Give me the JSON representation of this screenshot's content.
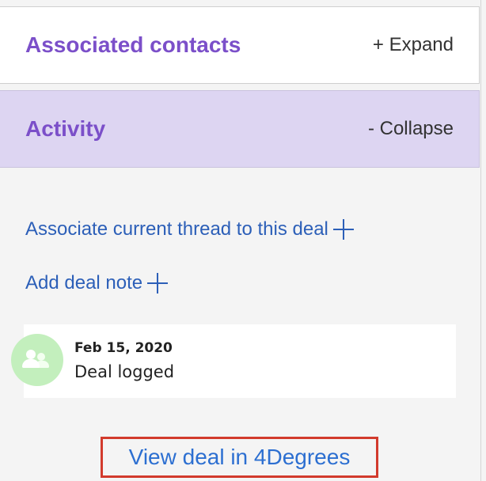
{
  "associated_contacts": {
    "title": "Associated contacts",
    "toggle_label": "+ Expand"
  },
  "activity": {
    "title": "Activity",
    "toggle_label": "- Collapse",
    "associate_thread_label": "Associate current thread to this deal",
    "add_note_label": "Add deal note",
    "items": [
      {
        "date": "Feb 15, 2020",
        "text": "Deal logged",
        "avatar_icon": "people-icon"
      }
    ]
  },
  "footer": {
    "view_deal_label": "View deal in 4Degrees"
  },
  "colors": {
    "accent_purple": "#7b4fc9",
    "activity_header_bg": "#ddd5f2",
    "link_blue": "#2c5fb8",
    "highlight_red": "#d23a2c",
    "avatar_green": "#c3efbd"
  }
}
